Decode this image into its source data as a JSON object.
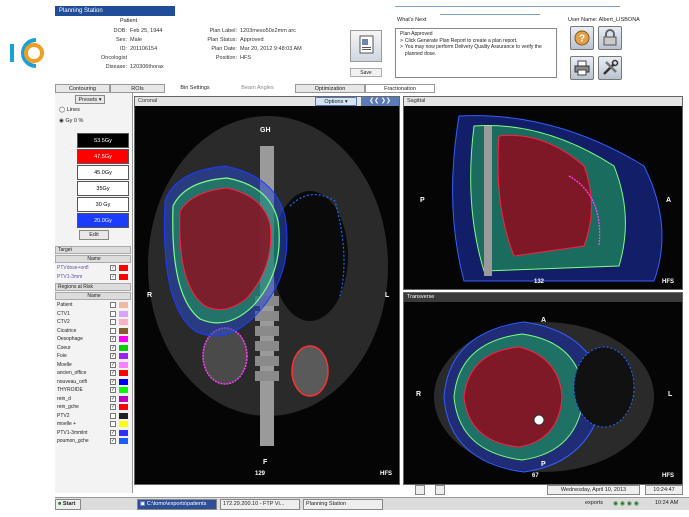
{
  "window": {
    "title": "Planning Station"
  },
  "patient": {
    "header": "Patient",
    "fields": [
      {
        "label": "DOB:",
        "value": "Feb 25, 1944"
      },
      {
        "label": "Sex:",
        "value": "Male"
      },
      {
        "label": "ID:",
        "value": "201106154"
      },
      {
        "label": "Oncologist",
        "value": ""
      },
      {
        "label": "Disease:",
        "value": "120306thorax"
      }
    ]
  },
  "plan": {
    "fields": [
      {
        "label": "Plan Label:",
        "value": "1203meso50x2mm arc"
      },
      {
        "label": "Plan Status:",
        "value": "Approved"
      },
      {
        "label": "Plan Date:",
        "value": "Mar 20, 2012 9:48:03 AM"
      },
      {
        "label": "Position:",
        "value": "HFS"
      }
    ],
    "save_label": "Save"
  },
  "whats_next": {
    "title": "What's Next",
    "status": "Plan Approved",
    "line1": "Click Generate Plan Report to create a plan report.",
    "line2": "You may now perform Delivery Quality Assurance to verify the planned dose."
  },
  "user": {
    "label": "User Name: Albert_LISBONA"
  },
  "tabs": [
    "Contouring",
    "ROIs",
    "Bin Settings",
    "Beam Angles",
    "Optimization",
    "Fractionation"
  ],
  "left": {
    "presets": "Presets",
    "lines": "Lines",
    "gy_pct": "Gy",
    "pct": "%",
    "zero": "0",
    "doses": [
      {
        "label": "53.5Gy",
        "bg": "#000000",
        "fg": "#ffffff"
      },
      {
        "label": "47.5Gy",
        "bg": "#ff0000",
        "fg": "#ffffff"
      },
      {
        "label": "45.0Gy",
        "bg": "#ffffff",
        "fg": "#000000"
      },
      {
        "label": "35Gy",
        "bg": "#ffffff",
        "fg": "#000000"
      },
      {
        "label": "30 Gy",
        "bg": "#ffffff",
        "fg": "#000000"
      },
      {
        "label": "20.0Gy",
        "bg": "#1a3cff",
        "fg": "#ffffff"
      }
    ],
    "edit": "Edit",
    "target_header": "Target",
    "name_header": "Name",
    "targets": [
      {
        "name": "PTVdose+onfl",
        "checked": true,
        "color": "#ff0000"
      },
      {
        "name": "PTV1-3mm",
        "checked": true,
        "color": "#ff0000"
      }
    ],
    "risk_header": "Regions at Risk",
    "risks": [
      {
        "name": "Patient",
        "checked": false,
        "color": "#f2b8a0"
      },
      {
        "name": "CTV1",
        "checked": false,
        "color": "#d9a0ff"
      },
      {
        "name": "CTV2",
        "checked": false,
        "color": "#ffb0c0"
      },
      {
        "name": "Cicatrice",
        "checked": false,
        "color": "#8b5a2b"
      },
      {
        "name": "Oesophage",
        "checked": true,
        "color": "#ff00ff"
      },
      {
        "name": "Coeur",
        "checked": true,
        "color": "#00d000"
      },
      {
        "name": "Foie",
        "checked": true,
        "color": "#a020f0"
      },
      {
        "name": "Moelle",
        "checked": true,
        "color": "#ff7fff"
      },
      {
        "name": "ancien_office",
        "checked": true,
        "color": "#ff0000"
      },
      {
        "name": "nouveau_orifi",
        "checked": true,
        "color": "#0000ff"
      },
      {
        "name": "THYROIDE",
        "checked": true,
        "color": "#00ff00"
      },
      {
        "name": "rein_d",
        "checked": true,
        "color": "#c000c0"
      },
      {
        "name": "rein_gche",
        "checked": true,
        "color": "#ff0000"
      },
      {
        "name": "PTV2",
        "checked": false,
        "color": "#202020"
      },
      {
        "name": "moelle +",
        "checked": false,
        "color": "#ffff00"
      },
      {
        "name": "PTV1-3mmlnt",
        "checked": true,
        "color": "#3030ff"
      },
      {
        "name": "poumon_gche",
        "checked": true,
        "color": "#1a60ff"
      }
    ]
  },
  "viewers": {
    "coronal": {
      "title": "Coronal",
      "options": "Options",
      "top": "GH",
      "left": "R",
      "right": "L",
      "bottom": "F",
      "slice": "129",
      "orient": "HFS"
    },
    "sagittal": {
      "title": "Sagittal",
      "left": "P",
      "right": "A",
      "slice": "132",
      "orient": "HFS"
    },
    "transverse": {
      "title": "Transverse",
      "top": "A",
      "left": "R",
      "right": "L",
      "bottom": "P",
      "slice": "67",
      "orient": "HFS"
    }
  },
  "status": {
    "date": "Wednesday, April 10, 2013",
    "time": "10:24:47"
  },
  "taskbar": {
    "start": "Start",
    "path": "C:\\tomo\\exports\\patients",
    "ftp": "172.29.200.10 - FTP Vi...",
    "app": "Planning Station",
    "tray_label": "exports",
    "clock": "10:24 AM"
  }
}
